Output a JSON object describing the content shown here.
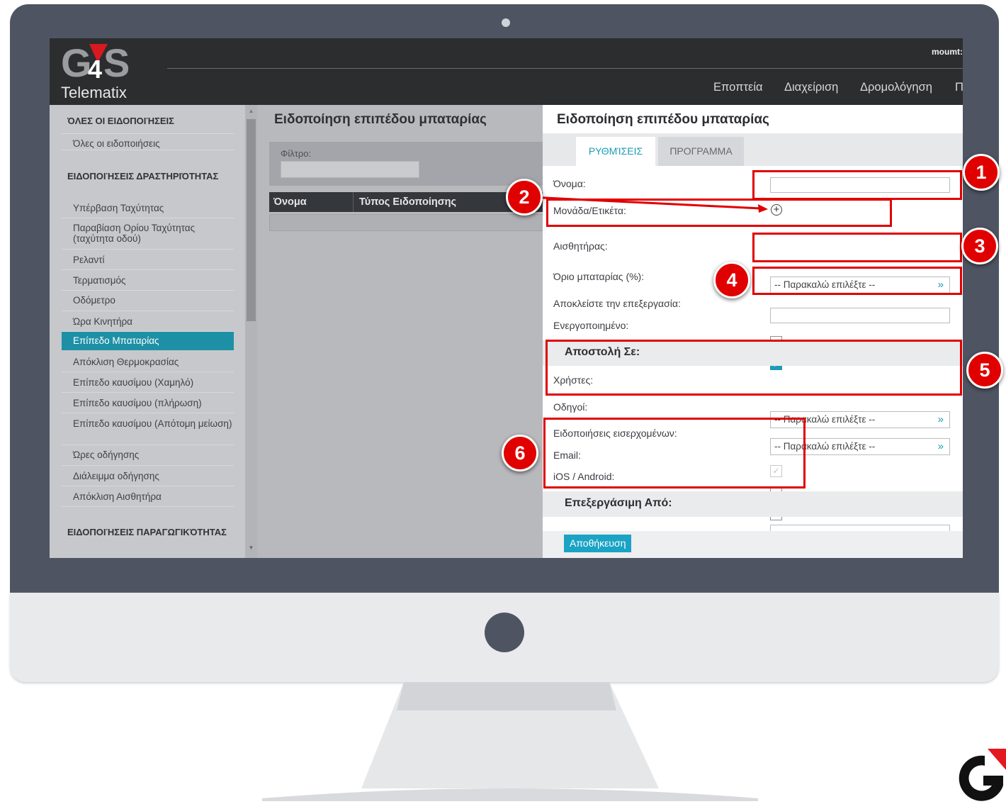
{
  "brand": {
    "logo_text": "G4S",
    "product": "Telematix",
    "accent_color": "#1a9cb5",
    "annotation_color": "#e00000"
  },
  "header": {
    "user": "moumt:",
    "nav": [
      "Εποπτεία",
      "Διαχείριση",
      "Δρομολόγηση",
      "Π"
    ]
  },
  "sidebar": {
    "group_all": "ΌΛΕΣ ΟΙ ΕΙΔΟΠΟΙΉΣΕΙΣ",
    "item_all": "Όλες οι ειδοποιήσεις",
    "group_activity": "ΕΙΔΟΠΟΙΉΣΕΙΣ ΔΡΑΣΤΗΡΙΌΤΗΤΑΣ",
    "items": [
      "Υπέρβαση Ταχύτητας",
      "Παραβίαση Ορίου Ταχύτητας (ταχύτητα οδού)",
      "Ρελαντί",
      "Τερματισμός",
      "Οδόμετρο",
      "Ώρα Κινητήρα",
      "Επίπεδο Μπαταρίας",
      "Απόκλιση Θερμοκρασίας",
      "Επίπεδο καυσίμου (Χαμηλό)",
      "Επίπεδο καυσίμου (πλήρωση)",
      "Επίπεδο καυσίμου (Απότομη μείωση)",
      "Ώρες οδήγησης",
      "Διάλειμμα οδήγησης",
      "Απόκλιση Αισθητήρα"
    ],
    "group_productivity": "ΕΙΔΟΠΟΙΉΣΕΙΣ ΠΑΡΑΓΩΓΙΚΌΤΗΤΑΣ",
    "active_item": "Επίπεδο Μπαταρίας"
  },
  "list": {
    "title": "Ειδοποίηση επιπέδου μπαταρίας",
    "filter_label": "Φίλτρο:",
    "filter_value": "",
    "columns": [
      "Όνομα",
      "Τύπος Ειδοποίησης"
    ]
  },
  "form": {
    "title": "Ειδοποίηση επιπέδου μπαταρίας",
    "tabs": [
      "ΡΥΘΜΊΣΕΙΣ",
      "ΠΡΟΓΡΑΜΜΑ"
    ],
    "active_tab": "ΡΥΘΜΊΣΕΙΣ",
    "name_label": "Όνομα:",
    "name_value": "",
    "unit_label": "Μονάδα/Ετικέτα:",
    "sensor_label": "Αισθητήρας:",
    "select_placeholder": "-- Παρακαλώ επιλέξτε --",
    "battery_label": "Όριο μπαταρίας (%):",
    "battery_value": "",
    "exclude_label": "Αποκλείστε την επεξεργασία:",
    "exclude_checked": false,
    "enabled_label": "Ενεργοποιημένο:",
    "enabled_checked": true,
    "send_to_header": "Αποστολή Σε:",
    "users_label": "Χρήστες:",
    "drivers_label": "Οδηγοί:",
    "inbox_label": "Ειδοποιήσεις εισερχομένων:",
    "inbox_checked": true,
    "email_label": "Email:",
    "email_checked": false,
    "mobile_label": "iOS / Android:",
    "mobile_checked": false,
    "processed_from_header": "Επεξεργάσιμη Από:",
    "save_label": "Αποθήκευση"
  },
  "annotations": [
    "1",
    "2",
    "3",
    "4",
    "5",
    "6"
  ]
}
